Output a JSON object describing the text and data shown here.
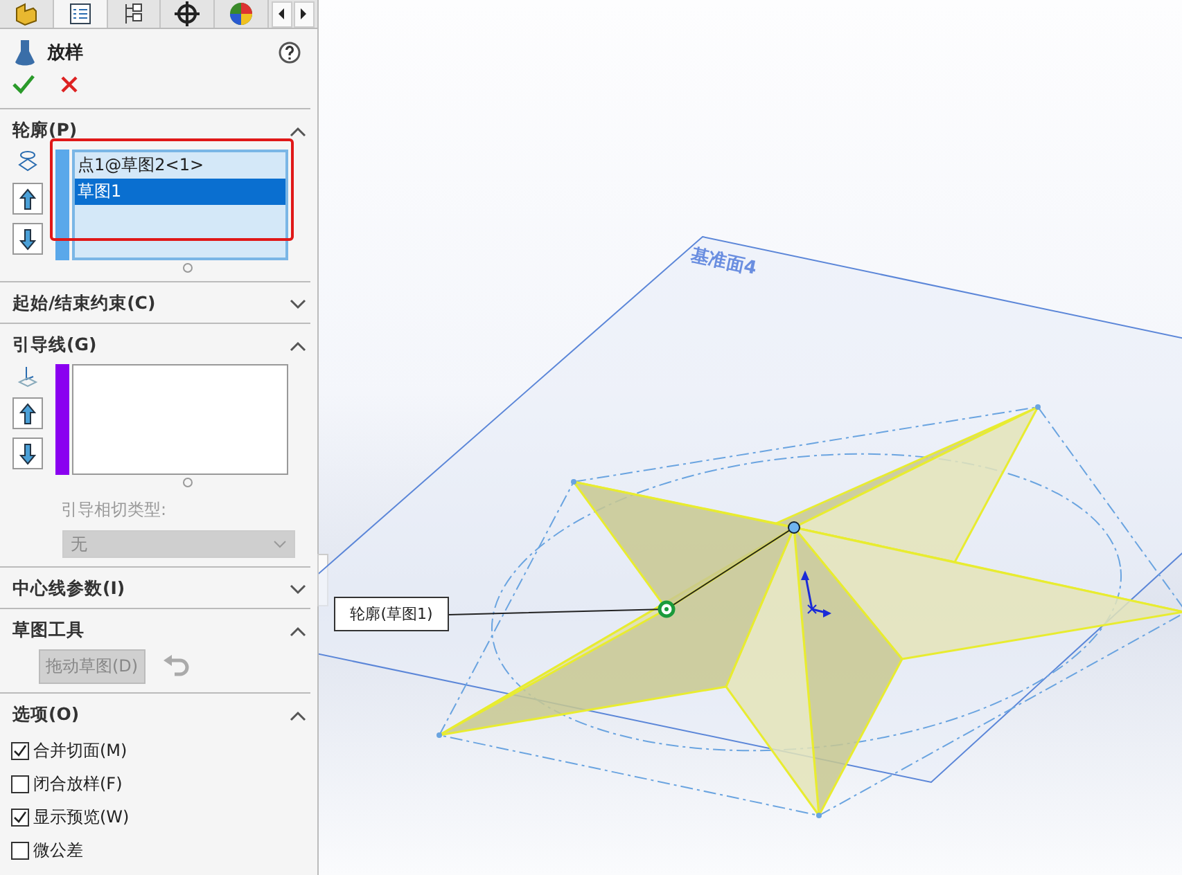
{
  "tabs": [
    {
      "kind": "part",
      "selected": false
    },
    {
      "kind": "properties",
      "selected": true
    },
    {
      "kind": "config",
      "selected": false
    },
    {
      "kind": "target",
      "selected": false
    },
    {
      "kind": "appearance",
      "selected": false
    }
  ],
  "feature": {
    "title": "放样"
  },
  "sections": [
    {
      "kind": "profile",
      "title": "轮廓(P)",
      "expanded": true,
      "items": [
        {
          "label": "点1@草图2<1>",
          "selected": false
        },
        {
          "label": "草图1",
          "selected": true
        }
      ],
      "highlighted": true
    },
    {
      "kind": "plain",
      "title": "起始/结束约束(C)",
      "expanded": false
    },
    {
      "kind": "guide",
      "title": "引导线(G)",
      "expanded": true,
      "tangency_label": "引导相切类型:",
      "tangency_value": "无",
      "tangency_disabled": true
    },
    {
      "kind": "plain",
      "title": "中心线参数(I)",
      "expanded": false
    },
    {
      "kind": "tools",
      "title": "草图工具",
      "expanded": true,
      "button": "拖动草图(D)",
      "button_disabled": true
    },
    {
      "kind": "options",
      "title": "选项(O)",
      "expanded": true,
      "options": [
        {
          "label": "合并切面(M)",
          "checked": true
        },
        {
          "label": "闭合放样(F)",
          "checked": false
        },
        {
          "label": "显示预览(W)",
          "checked": true
        },
        {
          "label": "微公差",
          "checked": false
        }
      ]
    }
  ],
  "viewport": {
    "plane_label": "基准面4",
    "callout": "轮廓(草图1)"
  }
}
